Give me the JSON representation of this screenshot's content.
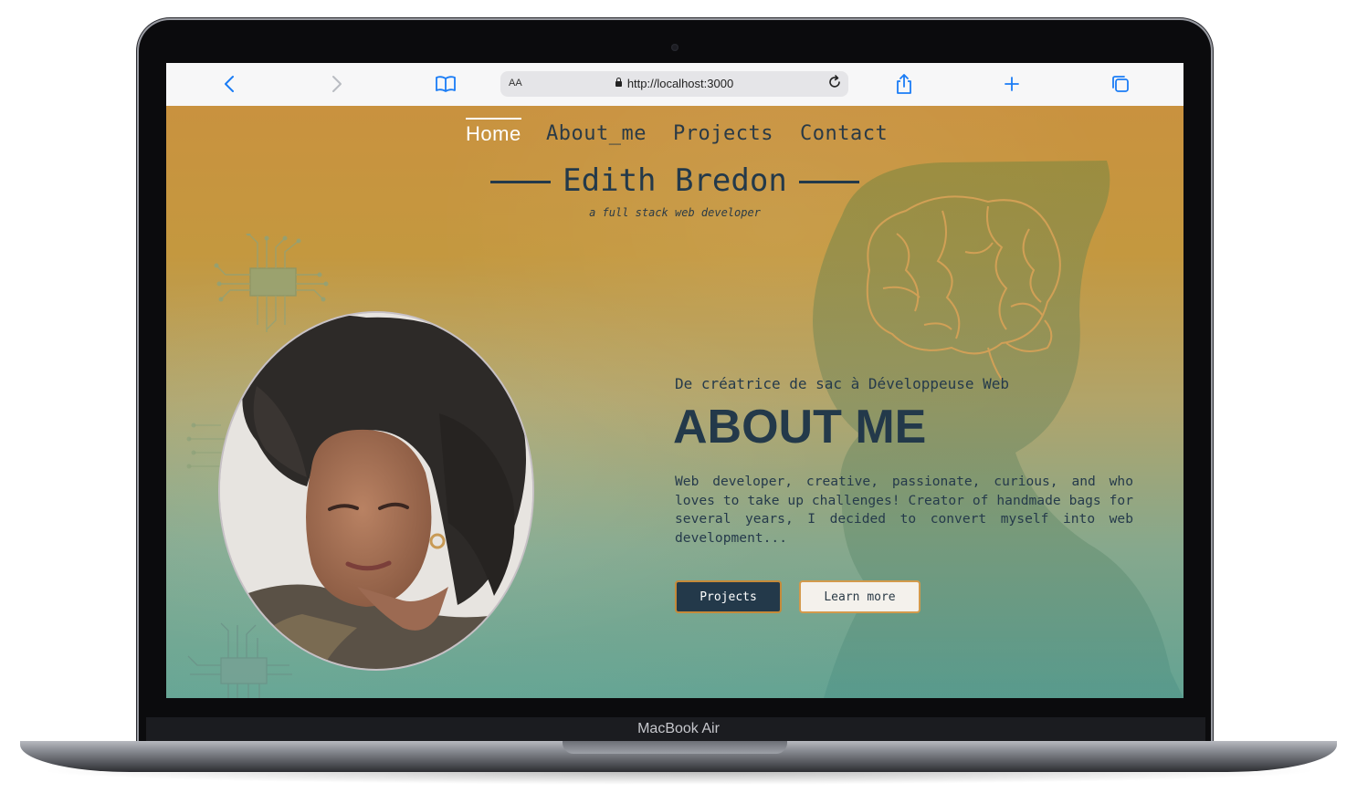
{
  "device": {
    "name": "MacBook Air"
  },
  "browser": {
    "address_text_size_label": "AA",
    "url": "http://localhost:3000",
    "icons": {
      "back": "chevron-left-icon",
      "forward": "chevron-right-icon",
      "bookmarks": "book-icon",
      "lock": "lock-icon",
      "reload": "reload-icon",
      "share": "share-icon",
      "new_tab": "plus-icon",
      "tabs": "tabs-icon"
    },
    "accent": "#1a7cf5"
  },
  "nav": {
    "items": [
      {
        "label": "Home",
        "active": true
      },
      {
        "label": "About_me",
        "active": false
      },
      {
        "label": "Projects",
        "active": false
      },
      {
        "label": "Contact",
        "active": false
      }
    ]
  },
  "hero": {
    "name": "Edith Bredon",
    "subtitle": "a full stack web developer",
    "tagline": "De créatrice de sac à Développeuse Web",
    "heading": "ABOUT ME",
    "description": "Web developer, creative, passionate, curious, and who loves to take up challenges! Creator of handmade bags for several years, I decided to convert myself into web development...",
    "buttons": {
      "primary": "Projects",
      "secondary": "Learn more"
    }
  },
  "colors": {
    "gradient_top": "#c9923f",
    "gradient_bottom": "#63a393",
    "text_dark": "#23394a",
    "button_border": "#c58a3a"
  }
}
